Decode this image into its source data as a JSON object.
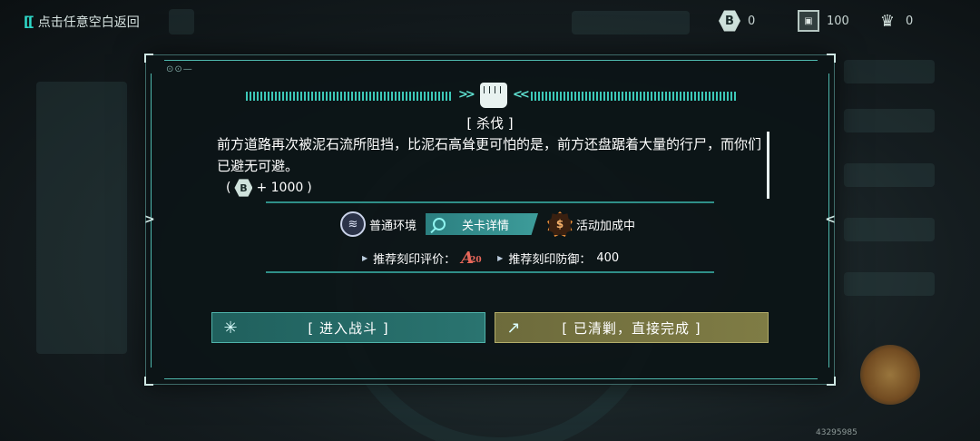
{
  "topbar": {
    "back_label": "点击任意空白返回",
    "resources": [
      {
        "icon": "hex-currency-icon",
        "glyph": "B",
        "value": "0"
      },
      {
        "icon": "chip-icon",
        "glyph": "▣",
        "value": "100"
      },
      {
        "icon": "trophy-icon",
        "glyph": "♛",
        "value": "0"
      }
    ]
  },
  "dialog": {
    "title": "[ 杀伐 ]",
    "description": "前方道路再次被泥石流所阻挡，比泥石高耸更可怕的是，前方还盘踞着大量的行尸，而你们已避无可避。",
    "reward": {
      "open": "(",
      "glyph": "B",
      "amount": "+ 1000",
      "close": ")"
    },
    "tags": {
      "environment": "普通环境",
      "detail_button": "关卡详情",
      "event": "活动加成中"
    },
    "recommend": {
      "rating_label": "推荐刻印评价：",
      "rating_letter": "A",
      "rating_number": "20",
      "defense_label": "推荐刻印防御：",
      "defense_value": "400"
    },
    "buttons": {
      "fight": "[ 进入战斗 ]",
      "clear": "[ 已清剿，直接完成 ]"
    }
  },
  "footer_code": "43295985",
  "colors": {
    "accent": "#3dc8b8",
    "fight_btn": "#2a7470",
    "clear_btn": "#7f7c45",
    "rating": "#e8675a"
  }
}
